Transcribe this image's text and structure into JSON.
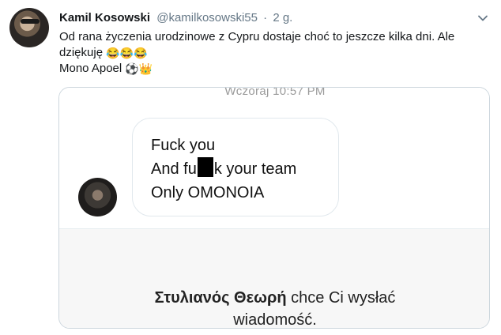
{
  "tweet": {
    "display_name": "Kamil Kosowski",
    "handle": "@kamilkosowski55",
    "separator": "·",
    "time": "2 g.",
    "text_line1": "Od rana życzenia  urodzinowe z Cypru dostaje choć to jeszcze kilka dni. Ale",
    "text_line2_prefix": "dziękuję",
    "text_line2_emojis": "😂😂😂",
    "text_line3_prefix": "Mono Apoel",
    "text_line3_emoji_ball": "⚽",
    "text_line3_emoji_crown": "👑"
  },
  "media": {
    "timestamp": "Wczoraj 10:57 PM",
    "message": {
      "line1": "Fuck you",
      "line2_before": "And fu",
      "line2_after": "k your team",
      "line3": "Only OMONOIA"
    },
    "request": {
      "sender_name": "Στυλιανός Θεωρή",
      "text_rest": "chce Ci wysłać",
      "text_line2": "wiadomość."
    }
  },
  "colors": {
    "secondary_text": "#657786",
    "border": "#ccd6dd",
    "request_bg": "#f7f7f7"
  },
  "icons": {
    "caret": "chevron-down-icon"
  }
}
